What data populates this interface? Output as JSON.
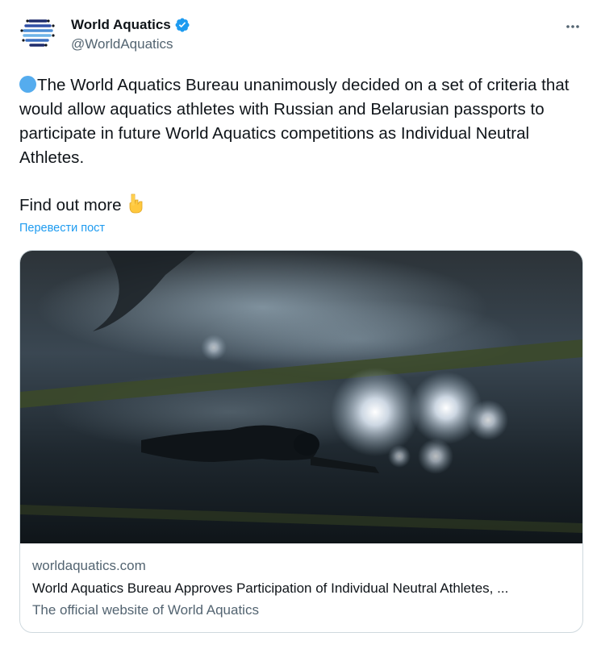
{
  "author": {
    "name": "World Aquatics",
    "handle": "@WorldAquatics",
    "verified": true
  },
  "tweet": {
    "text": "The World Aquatics Bureau unanimously decided on a set of criteria that would allow aquatics athletes with Russian and Belarusian passports to participate in future World Aquatics competitions as Individual Neutral Athletes.",
    "find_more": "Find out more",
    "translate_label": "Перевести пост"
  },
  "card": {
    "domain": "worldaquatics.com",
    "title": "World Aquatics Bureau Approves Participation of Individual Neutral Athletes, ...",
    "description": "The official website of World Aquatics"
  },
  "icons": {
    "more": "more-horizontal-icon",
    "verified": "verified-badge-icon",
    "emoji_circle": "blue-circle-emoji",
    "emoji_point": "backhand-index-pointing-down-emoji"
  },
  "colors": {
    "accent": "#1d9bf0",
    "text": "#0f1419",
    "secondary": "#536471",
    "border": "#cfd9de"
  }
}
